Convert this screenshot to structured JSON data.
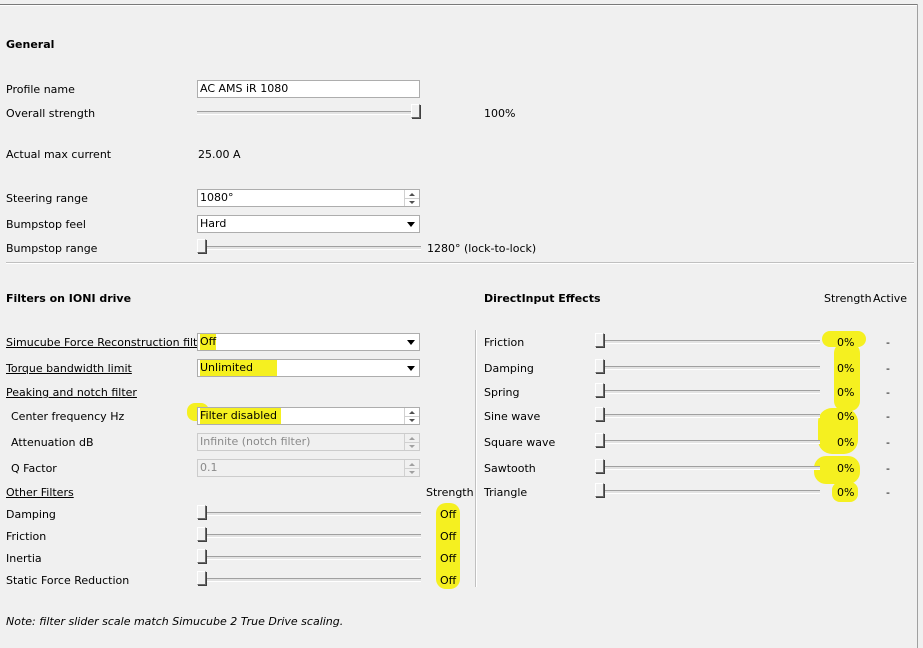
{
  "general": {
    "heading": "General",
    "profile_name_label": "Profile name",
    "profile_name_value": "AC AMS iR 1080",
    "overall_strength_label": "Overall strength",
    "overall_strength_value": "100%",
    "overall_strength_fraction": 1.0,
    "actual_max_current_label": "Actual max current",
    "actual_max_current_value": "25.00 A",
    "steering_range_label": "Steering range",
    "steering_range_value": "1080°",
    "bumpstop_feel_label": "Bumpstop feel",
    "bumpstop_feel_value": "Hard",
    "bumpstop_range_label": "Bumpstop range",
    "bumpstop_range_value": "1280° (lock-to-lock)",
    "bumpstop_range_fraction": 0.0
  },
  "filters": {
    "heading": "Filters on IONI drive",
    "reconstruction_label": "Simucube Force Reconstruction filter™",
    "reconstruction_value": "Off",
    "torque_label": "Torque bandwidth limit",
    "torque_value": "Unlimited",
    "peaking_label": "Peaking and notch filter",
    "center_freq_label": "Center frequency Hz",
    "center_freq_value": "Filter disabled",
    "attenuation_label": "Attenuation dB",
    "attenuation_value": "Infinite (notch filter)",
    "q_factor_label": "Q Factor",
    "q_factor_value": "0.1",
    "other_filters_label": "Other Filters",
    "strength_header": "Strength",
    "items": [
      {
        "label": "Damping",
        "value": "Off"
      },
      {
        "label": "Friction",
        "value": "Off"
      },
      {
        "label": "Inertia",
        "value": "Off"
      },
      {
        "label": "Static Force Reduction",
        "value": "Off"
      }
    ],
    "note": "Note: filter slider scale match Simucube 2 True Drive scaling."
  },
  "directinput": {
    "heading": "DirectInput Effects",
    "strength_header": "Strength",
    "active_header": "Active",
    "effects": [
      {
        "label": "Friction",
        "value": "0%",
        "active": "-"
      },
      {
        "label": "Damping",
        "value": "0%",
        "active": "-"
      },
      {
        "label": "Spring",
        "value": "0%",
        "active": "-"
      },
      {
        "label": "Sine wave",
        "value": "0%",
        "active": "-"
      },
      {
        "label": "Square wave",
        "value": "0%",
        "active": "-"
      },
      {
        "label": "Sawtooth",
        "value": "0%",
        "active": "-"
      },
      {
        "label": "Triangle",
        "value": "0%",
        "active": "-"
      }
    ]
  },
  "colors": {
    "highlight": "#f5f020",
    "background": "#f0f0f0"
  }
}
